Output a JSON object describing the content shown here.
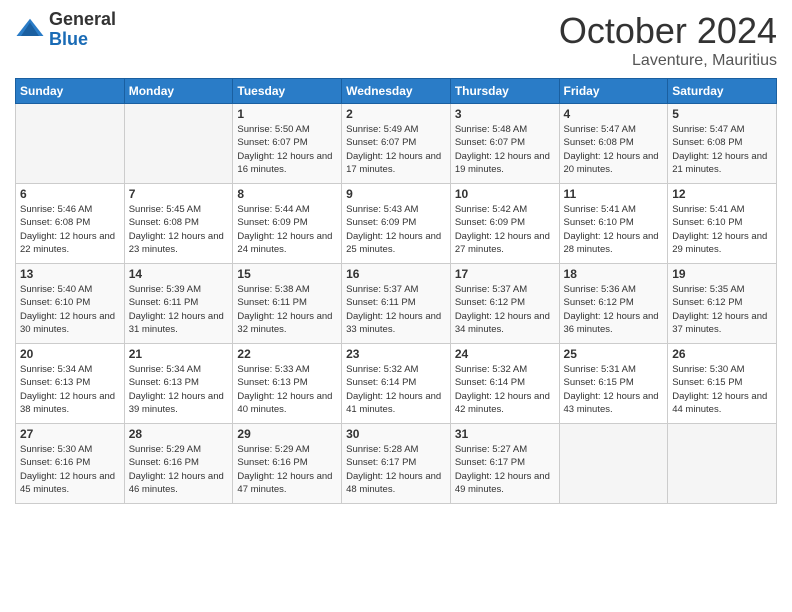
{
  "logo": {
    "general": "General",
    "blue": "Blue"
  },
  "header": {
    "month": "October 2024",
    "location": "Laventure, Mauritius"
  },
  "days_of_week": [
    "Sunday",
    "Monday",
    "Tuesday",
    "Wednesday",
    "Thursday",
    "Friday",
    "Saturday"
  ],
  "weeks": [
    [
      {
        "day": "",
        "sunrise": "",
        "sunset": "",
        "daylight": ""
      },
      {
        "day": "",
        "sunrise": "",
        "sunset": "",
        "daylight": ""
      },
      {
        "day": "1",
        "sunrise": "Sunrise: 5:50 AM",
        "sunset": "Sunset: 6:07 PM",
        "daylight": "Daylight: 12 hours and 16 minutes."
      },
      {
        "day": "2",
        "sunrise": "Sunrise: 5:49 AM",
        "sunset": "Sunset: 6:07 PM",
        "daylight": "Daylight: 12 hours and 17 minutes."
      },
      {
        "day": "3",
        "sunrise": "Sunrise: 5:48 AM",
        "sunset": "Sunset: 6:07 PM",
        "daylight": "Daylight: 12 hours and 19 minutes."
      },
      {
        "day": "4",
        "sunrise": "Sunrise: 5:47 AM",
        "sunset": "Sunset: 6:08 PM",
        "daylight": "Daylight: 12 hours and 20 minutes."
      },
      {
        "day": "5",
        "sunrise": "Sunrise: 5:47 AM",
        "sunset": "Sunset: 6:08 PM",
        "daylight": "Daylight: 12 hours and 21 minutes."
      }
    ],
    [
      {
        "day": "6",
        "sunrise": "Sunrise: 5:46 AM",
        "sunset": "Sunset: 6:08 PM",
        "daylight": "Daylight: 12 hours and 22 minutes."
      },
      {
        "day": "7",
        "sunrise": "Sunrise: 5:45 AM",
        "sunset": "Sunset: 6:08 PM",
        "daylight": "Daylight: 12 hours and 23 minutes."
      },
      {
        "day": "8",
        "sunrise": "Sunrise: 5:44 AM",
        "sunset": "Sunset: 6:09 PM",
        "daylight": "Daylight: 12 hours and 24 minutes."
      },
      {
        "day": "9",
        "sunrise": "Sunrise: 5:43 AM",
        "sunset": "Sunset: 6:09 PM",
        "daylight": "Daylight: 12 hours and 25 minutes."
      },
      {
        "day": "10",
        "sunrise": "Sunrise: 5:42 AM",
        "sunset": "Sunset: 6:09 PM",
        "daylight": "Daylight: 12 hours and 27 minutes."
      },
      {
        "day": "11",
        "sunrise": "Sunrise: 5:41 AM",
        "sunset": "Sunset: 6:10 PM",
        "daylight": "Daylight: 12 hours and 28 minutes."
      },
      {
        "day": "12",
        "sunrise": "Sunrise: 5:41 AM",
        "sunset": "Sunset: 6:10 PM",
        "daylight": "Daylight: 12 hours and 29 minutes."
      }
    ],
    [
      {
        "day": "13",
        "sunrise": "Sunrise: 5:40 AM",
        "sunset": "Sunset: 6:10 PM",
        "daylight": "Daylight: 12 hours and 30 minutes."
      },
      {
        "day": "14",
        "sunrise": "Sunrise: 5:39 AM",
        "sunset": "Sunset: 6:11 PM",
        "daylight": "Daylight: 12 hours and 31 minutes."
      },
      {
        "day": "15",
        "sunrise": "Sunrise: 5:38 AM",
        "sunset": "Sunset: 6:11 PM",
        "daylight": "Daylight: 12 hours and 32 minutes."
      },
      {
        "day": "16",
        "sunrise": "Sunrise: 5:37 AM",
        "sunset": "Sunset: 6:11 PM",
        "daylight": "Daylight: 12 hours and 33 minutes."
      },
      {
        "day": "17",
        "sunrise": "Sunrise: 5:37 AM",
        "sunset": "Sunset: 6:12 PM",
        "daylight": "Daylight: 12 hours and 34 minutes."
      },
      {
        "day": "18",
        "sunrise": "Sunrise: 5:36 AM",
        "sunset": "Sunset: 6:12 PM",
        "daylight": "Daylight: 12 hours and 36 minutes."
      },
      {
        "day": "19",
        "sunrise": "Sunrise: 5:35 AM",
        "sunset": "Sunset: 6:12 PM",
        "daylight": "Daylight: 12 hours and 37 minutes."
      }
    ],
    [
      {
        "day": "20",
        "sunrise": "Sunrise: 5:34 AM",
        "sunset": "Sunset: 6:13 PM",
        "daylight": "Daylight: 12 hours and 38 minutes."
      },
      {
        "day": "21",
        "sunrise": "Sunrise: 5:34 AM",
        "sunset": "Sunset: 6:13 PM",
        "daylight": "Daylight: 12 hours and 39 minutes."
      },
      {
        "day": "22",
        "sunrise": "Sunrise: 5:33 AM",
        "sunset": "Sunset: 6:13 PM",
        "daylight": "Daylight: 12 hours and 40 minutes."
      },
      {
        "day": "23",
        "sunrise": "Sunrise: 5:32 AM",
        "sunset": "Sunset: 6:14 PM",
        "daylight": "Daylight: 12 hours and 41 minutes."
      },
      {
        "day": "24",
        "sunrise": "Sunrise: 5:32 AM",
        "sunset": "Sunset: 6:14 PM",
        "daylight": "Daylight: 12 hours and 42 minutes."
      },
      {
        "day": "25",
        "sunrise": "Sunrise: 5:31 AM",
        "sunset": "Sunset: 6:15 PM",
        "daylight": "Daylight: 12 hours and 43 minutes."
      },
      {
        "day": "26",
        "sunrise": "Sunrise: 5:30 AM",
        "sunset": "Sunset: 6:15 PM",
        "daylight": "Daylight: 12 hours and 44 minutes."
      }
    ],
    [
      {
        "day": "27",
        "sunrise": "Sunrise: 5:30 AM",
        "sunset": "Sunset: 6:16 PM",
        "daylight": "Daylight: 12 hours and 45 minutes."
      },
      {
        "day": "28",
        "sunrise": "Sunrise: 5:29 AM",
        "sunset": "Sunset: 6:16 PM",
        "daylight": "Daylight: 12 hours and 46 minutes."
      },
      {
        "day": "29",
        "sunrise": "Sunrise: 5:29 AM",
        "sunset": "Sunset: 6:16 PM",
        "daylight": "Daylight: 12 hours and 47 minutes."
      },
      {
        "day": "30",
        "sunrise": "Sunrise: 5:28 AM",
        "sunset": "Sunset: 6:17 PM",
        "daylight": "Daylight: 12 hours and 48 minutes."
      },
      {
        "day": "31",
        "sunrise": "Sunrise: 5:27 AM",
        "sunset": "Sunset: 6:17 PM",
        "daylight": "Daylight: 12 hours and 49 minutes."
      },
      {
        "day": "",
        "sunrise": "",
        "sunset": "",
        "daylight": ""
      },
      {
        "day": "",
        "sunrise": "",
        "sunset": "",
        "daylight": ""
      }
    ]
  ]
}
